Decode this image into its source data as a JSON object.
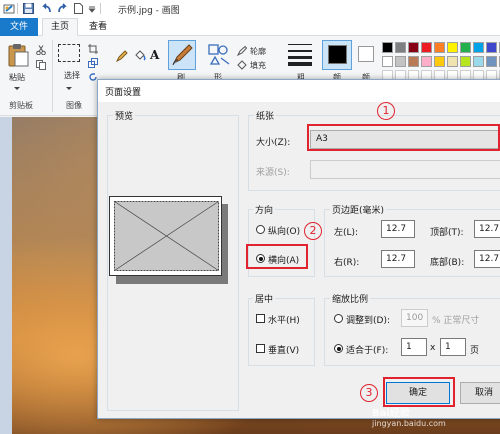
{
  "app": {
    "title": "示例.jpg - 画图"
  },
  "ribbon": {
    "tabs": [
      "文件",
      "主页",
      "查看"
    ],
    "paste_label": "粘贴",
    "select_label": "选\n择",
    "select_label_text": "选择",
    "brush_label": "刷",
    "shapes_label": "形",
    "size_label": "粗",
    "color1_label": "颜",
    "color2_label": "颜",
    "outline_label": "轮廓",
    "fill_label": "填充",
    "groups": [
      "剪贴板",
      "图像"
    ],
    "palette": [
      "#000000",
      "#7f7f7f",
      "#880015",
      "#ed1c24",
      "#ff7f27",
      "#fff200",
      "#22b14c",
      "#00a2e8",
      "#3f48cc",
      "#a349a4",
      "#ffffff",
      "#c3c3c3",
      "#b97a57",
      "#ffaec9",
      "#ffc90e",
      "#efe4b0",
      "#b5e61d",
      "#99d9ea",
      "#7092be",
      "#c8bfe7"
    ]
  },
  "dialog": {
    "title": "页面设置",
    "preview_label": "预览",
    "paper": {
      "label": "纸张",
      "size_label": "大小(Z):",
      "size_value": "A3",
      "source_label": "来源(S):"
    },
    "orientation": {
      "label": "方向",
      "portrait": "纵向(O)",
      "landscape": "横向(A)",
      "selected": "landscape"
    },
    "margins": {
      "label": "页边距(毫米)",
      "left_label": "左(L):",
      "left_value": "12.7",
      "top_label": "顶部(T):",
      "top_value": "12.7",
      "right_label": "右(R):",
      "right_value": "12.7",
      "bottom_label": "底部(B):",
      "bottom_value": "12.7"
    },
    "centering": {
      "label": "居中",
      "horizontal": "水平(H)",
      "vertical": "垂直(V)"
    },
    "scaling": {
      "label": "缩放比例",
      "adjust_label": "调整到(D):",
      "adjust_value": "100",
      "adjust_suffix": "% 正常尺寸",
      "fit_label": "适合于(F):",
      "fit_pages_x": "1",
      "x_sep": "x",
      "fit_pages_y": "1",
      "page_label": "页",
      "selected": "fit"
    },
    "ok_label": "确定",
    "cancel_label": "取消"
  },
  "annotations": {
    "step1": "1",
    "step2": "2",
    "step3": "3",
    "color": "#e0232f"
  },
  "watermark": {
    "text": "Bai经验",
    "url": "jingyan.baidu.com"
  }
}
